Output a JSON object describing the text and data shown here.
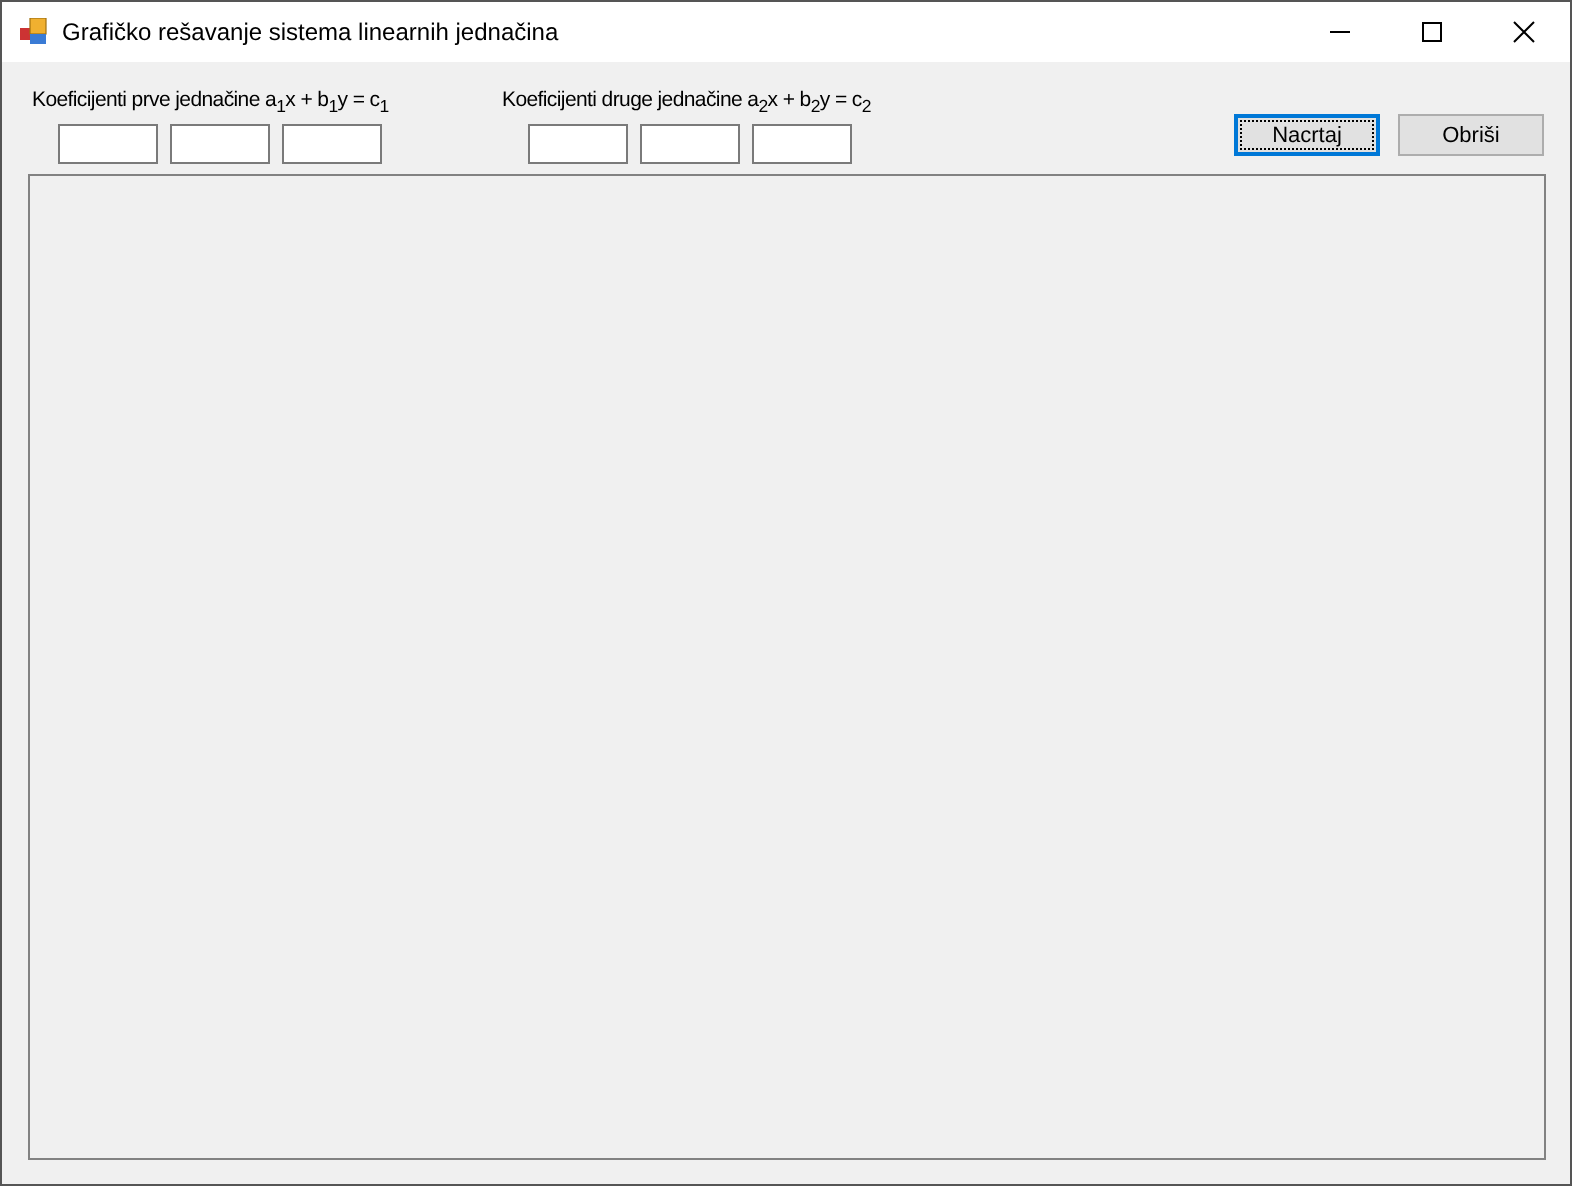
{
  "window": {
    "title": "Grafičko rešavanje sistema linearnih jednačina"
  },
  "groups": [
    {
      "label": "Koeficijenti prve jednačine a$_{1}$x + b$_{1}$y = c$_{1}$",
      "fields": [
        {
          "kind": "text"
        },
        {
          "kind": "text"
        },
        {
          "kind": "text"
        }
      ]
    },
    {
      "label": "Koeficijenti druge jednačine a$_{2}$x + b$_{2}$y = c$_{2}$",
      "fields": [
        {
          "kind": "text"
        },
        {
          "kind": "text"
        },
        {
          "kind": "text"
        }
      ]
    }
  ],
  "buttons": [
    {
      "label": "Nacrtaj",
      "focused": true
    },
    {
      "label": "Obriši",
      "focused": false
    }
  ]
}
